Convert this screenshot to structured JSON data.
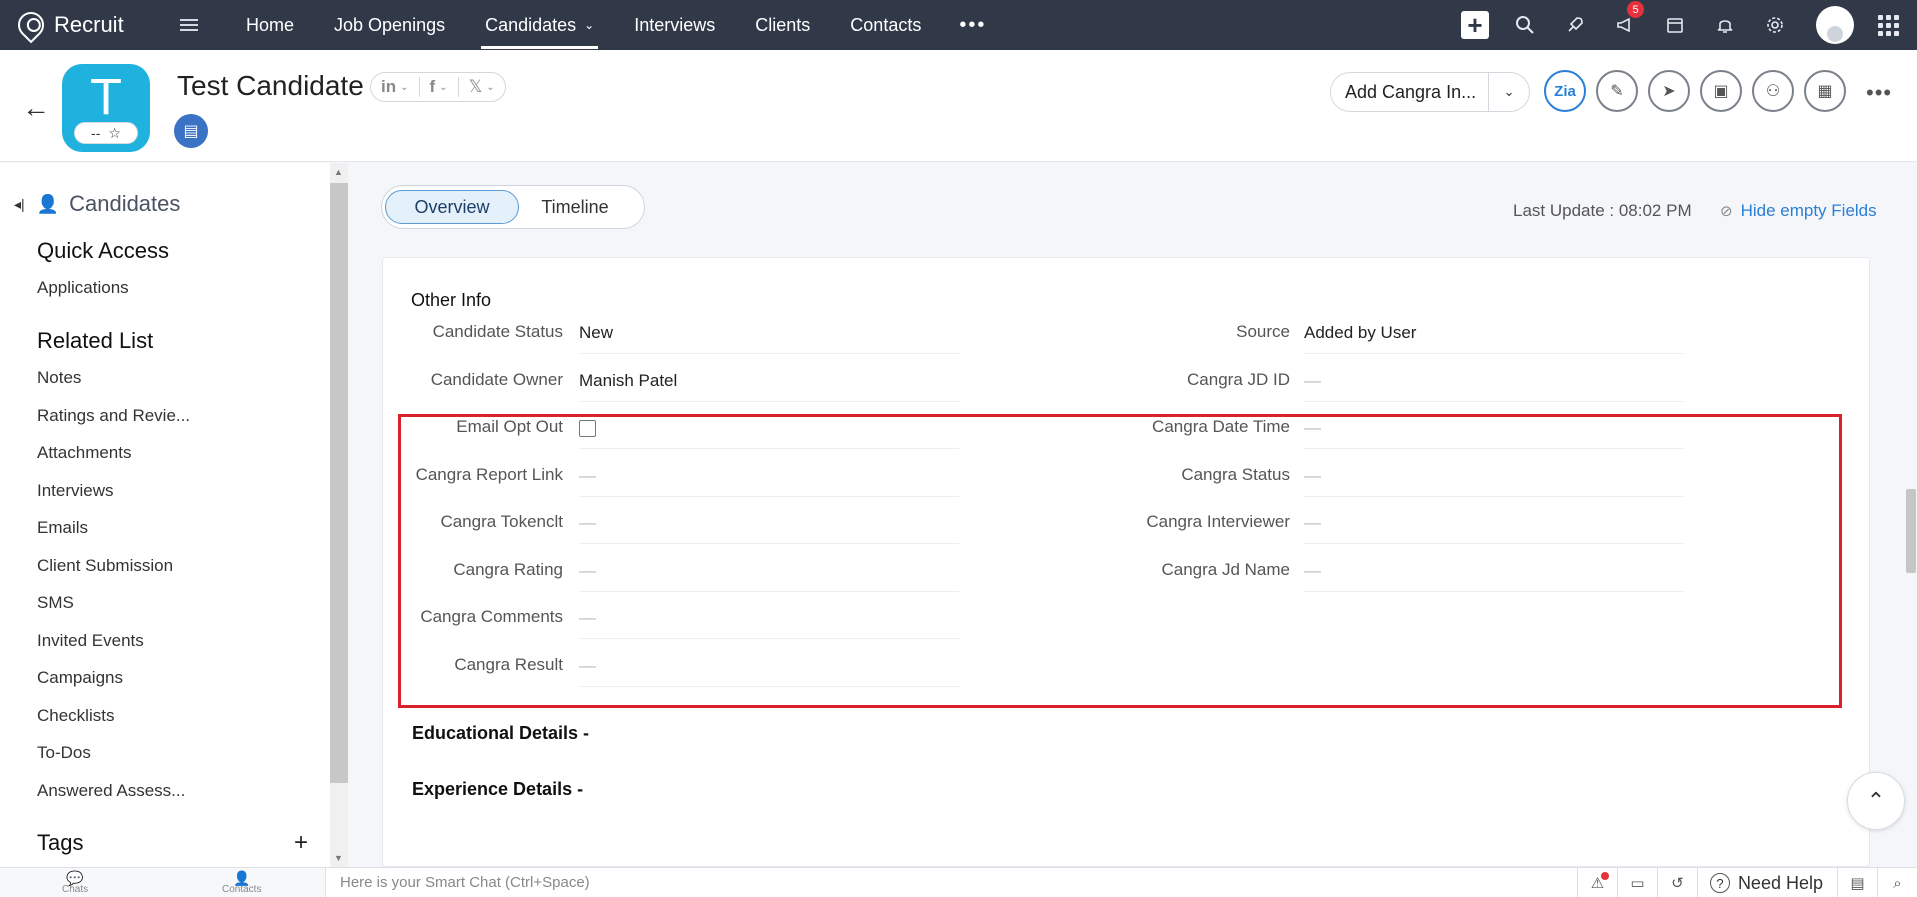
{
  "nav": {
    "brand": "Recruit",
    "tabs": [
      {
        "label": "Home"
      },
      {
        "label": "Job Openings"
      },
      {
        "label": "Candidates"
      },
      {
        "label": "Interviews"
      },
      {
        "label": "Clients"
      },
      {
        "label": "Contacts"
      }
    ],
    "more": "•••",
    "notification_count": "5",
    "icons": [
      "plus-icon",
      "search-icon",
      "rocket-icon",
      "megaphone-icon",
      "calendar-icon",
      "bell-icon",
      "gear-icon",
      "avatar",
      "apps-grid-icon"
    ]
  },
  "record": {
    "avatar_letter": "T",
    "rating_text": "--",
    "name": "Test Candidate",
    "socials": [
      "in",
      "f",
      "𝕏"
    ],
    "action_label": "Add Cangra In...",
    "zia_label": "Zia"
  },
  "sidebar": {
    "title": "Candidates",
    "quick_access": "Quick Access",
    "quick_items": [
      "Applications"
    ],
    "related_title": "Related List",
    "related_items": [
      "Notes",
      "Ratings and Revie...",
      "Attachments",
      "Interviews",
      "Emails",
      "Client Submission",
      "SMS",
      "Invited Events",
      "Campaigns",
      "Checklists",
      "To-Dos",
      "Answered Assess..."
    ],
    "tags_title": "Tags",
    "tags_add": "+"
  },
  "main": {
    "tabs": [
      "Overview",
      "Timeline"
    ],
    "last_update": "Last Update : 08:02 PM",
    "hide_empty": "Hide empty Fields",
    "section_title": "Other Info",
    "empty_dash": "—",
    "left_fields": [
      {
        "label": "Candidate Status",
        "value": "New"
      },
      {
        "label": "Candidate Owner",
        "value": "Manish Patel"
      },
      {
        "label": "Email Opt Out",
        "value": ""
      },
      {
        "label": "Cangra Report Link",
        "value": "—"
      },
      {
        "label": "Cangra Tokenclt",
        "value": "—"
      },
      {
        "label": "Cangra Rating",
        "value": "—"
      },
      {
        "label": "Cangra Comments",
        "value": "—"
      },
      {
        "label": "Cangra Result",
        "value": "—"
      }
    ],
    "right_fields": [
      {
        "label": "Source",
        "value": "Added by User"
      },
      {
        "label": "Cangra JD ID",
        "value": "—"
      },
      {
        "label": "Cangra Date Time",
        "value": "—"
      },
      {
        "label": "Cangra Status",
        "value": "—"
      },
      {
        "label": "Cangra Interviewer",
        "value": "—"
      },
      {
        "label": "Cangra Jd Name",
        "value": "—"
      }
    ],
    "educational_title": "Educational Details -",
    "experience_title": "Experience Details -"
  },
  "bottom": {
    "chats": "Chats",
    "contacts": "Contacts",
    "smart_chat_placeholder": "Here is your Smart Chat (Ctrl+Space)",
    "need_help": "Need Help"
  },
  "colors": {
    "nav_bg": "#313949",
    "avatar_bg": "#1fb2df",
    "accent": "#2a7fd6",
    "highlight": "#d8212b"
  }
}
